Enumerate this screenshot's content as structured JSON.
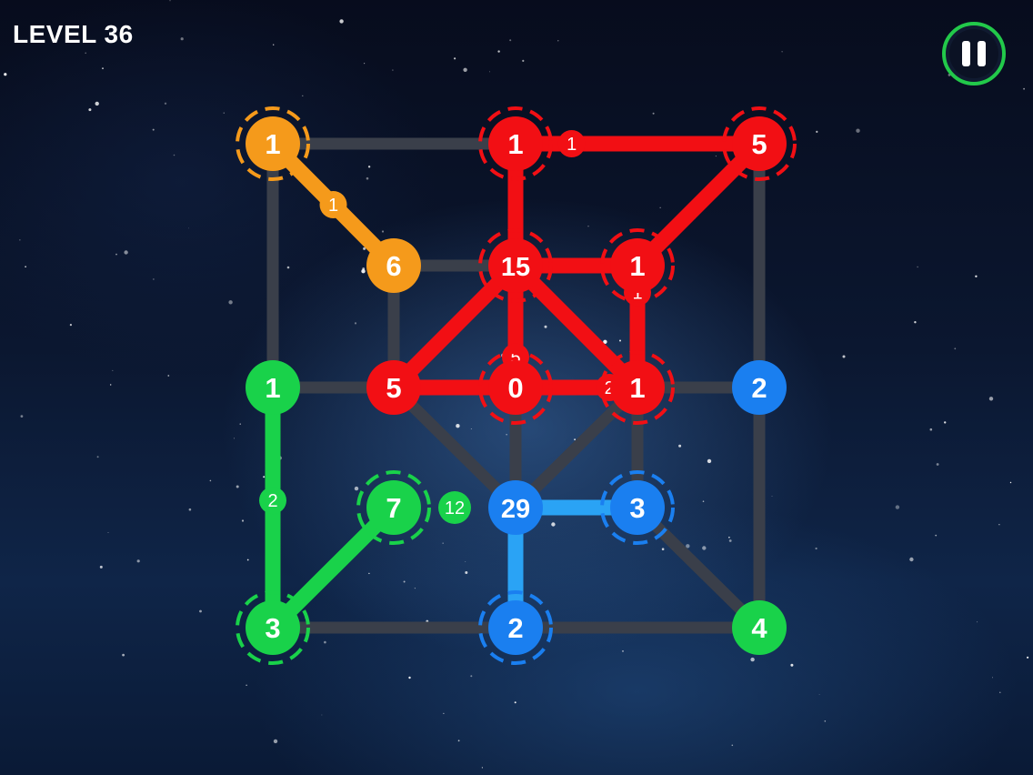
{
  "header": {
    "level_label": "LEVEL 36"
  },
  "icons": {
    "pause": "pause-icon"
  },
  "colors": {
    "background": "#0b1730",
    "unused_edge": "#3a3f4a",
    "orange": "#f59a1b",
    "red": "#f20f14",
    "green": "#19d24a",
    "blue": "#1a7ff0",
    "light_blue": "#2aa3f5",
    "pause_ring": "#22c94a"
  },
  "nodes": [
    {
      "id": "a",
      "row": 0,
      "col": 0,
      "label": "1",
      "color": "orange",
      "ring": true
    },
    {
      "id": "b",
      "row": 0,
      "col": 2,
      "label": "1",
      "color": "red",
      "ring": true
    },
    {
      "id": "c",
      "row": 0,
      "col": 4,
      "label": "5",
      "color": "red",
      "ring": true
    },
    {
      "id": "d",
      "row": 1,
      "col": 1,
      "label": "6",
      "color": "orange",
      "ring": false
    },
    {
      "id": "e",
      "row": 1,
      "col": 2,
      "label": "15",
      "color": "red",
      "ring": true
    },
    {
      "id": "f",
      "row": 1,
      "col": 3,
      "label": "1",
      "color": "red",
      "ring": true
    },
    {
      "id": "g",
      "row": 2,
      "col": 0,
      "label": "1",
      "color": "green",
      "ring": false
    },
    {
      "id": "h",
      "row": 2,
      "col": 1,
      "label": "5",
      "color": "red",
      "ring": false
    },
    {
      "id": "i",
      "row": 2,
      "col": 2,
      "label": "0",
      "color": "red",
      "ring": true
    },
    {
      "id": "j",
      "row": 2,
      "col": 3,
      "label": "1",
      "color": "red",
      "ring": true
    },
    {
      "id": "k",
      "row": 2,
      "col": 4,
      "label": "2",
      "color": "blue",
      "ring": false
    },
    {
      "id": "l",
      "row": 3,
      "col": 1,
      "label": "7",
      "color": "green",
      "ring": true
    },
    {
      "id": "m",
      "row": 3,
      "col": 2,
      "label": "29",
      "color": "blue",
      "ring": false
    },
    {
      "id": "n",
      "row": 3,
      "col": 3,
      "label": "3",
      "color": "blue",
      "ring": true
    },
    {
      "id": "o",
      "row": 4,
      "col": 0,
      "label": "3",
      "color": "green",
      "ring": true
    },
    {
      "id": "p",
      "row": 4,
      "col": 2,
      "label": "2",
      "color": "blue",
      "ring": true
    },
    {
      "id": "q",
      "row": 4,
      "col": 4,
      "label": "4",
      "color": "green",
      "ring": false
    }
  ],
  "edges": [
    {
      "from": "a",
      "to": "b",
      "color": "unused_edge"
    },
    {
      "from": "a",
      "to": "g",
      "color": "unused_edge"
    },
    {
      "from": "d",
      "to": "e",
      "color": "unused_edge"
    },
    {
      "from": "d",
      "to": "h",
      "color": "unused_edge"
    },
    {
      "from": "c",
      "to": "k",
      "color": "unused_edge"
    },
    {
      "from": "g",
      "to": "h",
      "color": "unused_edge"
    },
    {
      "from": "j",
      "to": "k",
      "color": "unused_edge"
    },
    {
      "from": "h",
      "to": "m",
      "color": "unused_edge"
    },
    {
      "from": "i",
      "to": "m",
      "color": "unused_edge"
    },
    {
      "from": "j",
      "to": "m",
      "color": "unused_edge"
    },
    {
      "from": "j",
      "to": "n",
      "color": "unused_edge"
    },
    {
      "from": "k",
      "to": "q",
      "color": "unused_edge"
    },
    {
      "from": "n",
      "to": "q",
      "color": "unused_edge"
    },
    {
      "from": "o",
      "to": "p",
      "color": "unused_edge"
    },
    {
      "from": "p",
      "to": "q",
      "color": "unused_edge"
    },
    {
      "from": "a",
      "to": "d",
      "color": "orange"
    },
    {
      "from": "b",
      "to": "c",
      "color": "red"
    },
    {
      "from": "b",
      "to": "e",
      "color": "red"
    },
    {
      "from": "c",
      "to": "f",
      "color": "red"
    },
    {
      "from": "e",
      "to": "f",
      "color": "red"
    },
    {
      "from": "e",
      "to": "h",
      "color": "red"
    },
    {
      "from": "e",
      "to": "i",
      "color": "red"
    },
    {
      "from": "e",
      "to": "j",
      "color": "red"
    },
    {
      "from": "f",
      "to": "j",
      "color": "red"
    },
    {
      "from": "h",
      "to": "i",
      "color": "red"
    },
    {
      "from": "i",
      "to": "j",
      "color": "red"
    },
    {
      "from": "g",
      "to": "o",
      "color": "green"
    },
    {
      "from": "l",
      "to": "o",
      "color": "green"
    },
    {
      "from": "m",
      "to": "n",
      "color": "light_blue"
    },
    {
      "from": "m",
      "to": "p",
      "color": "light_blue"
    }
  ],
  "edge_badges": [
    {
      "between": [
        "a",
        "d"
      ],
      "t": 0.5,
      "label": "1",
      "color": "orange"
    },
    {
      "between": [
        "b",
        "c"
      ],
      "t": 0.23,
      "label": "1",
      "color": "red"
    },
    {
      "between": [
        "g",
        "o"
      ],
      "t": 0.47,
      "label": "2",
      "color": "green"
    },
    {
      "between": [
        "l",
        "m"
      ],
      "t": 0.5,
      "label": "12",
      "color": "green"
    },
    {
      "between": [
        "f",
        "j"
      ],
      "t": 0.22,
      "label": "1",
      "color": "red"
    },
    {
      "between": [
        "e",
        "i"
      ],
      "t": 0.75,
      "label": "5",
      "color": "red"
    },
    {
      "between": [
        "i",
        "j"
      ],
      "t": 0.77,
      "label": "2",
      "color": "red"
    }
  ]
}
